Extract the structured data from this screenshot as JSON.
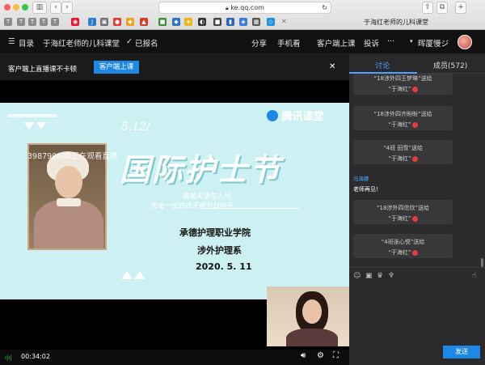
{
  "browser": {
    "url": "ke.qq.com",
    "tab_title": "于海红老师的儿科课堂",
    "fav_letters": [
      "T",
      "T",
      "T",
      "T",
      "T",
      "J"
    ]
  },
  "topnav": {
    "menu": "目录",
    "course_title": "于海红老师的儿科课堂",
    "enrolled": "已报名",
    "share": "分享",
    "watch_phone": "手机看",
    "client": "客户端上课",
    "complaint": "投诉",
    "dots": "···",
    "username": "晖厦慢ジ"
  },
  "banner": {
    "text": "客户端上直播课不卡顿",
    "button": "客户端上课",
    "close": "✕"
  },
  "slide": {
    "logo": "腾讯课堂",
    "date_tag": "5.12/",
    "viewer_watermark": "398799688正在观看直播",
    "headline": "国际护士节",
    "sub1": "最美天使在人间",
    "sub2": "祝每一位白衣天使节日快乐",
    "school": "承德护理职业学院",
    "dept": "涉外护理系",
    "date": "2020. 5. 11"
  },
  "controls": {
    "time": "00:34:02"
  },
  "panel": {
    "tab_discuss": "讨论",
    "tab_members": "成员(572)",
    "gifts": [
      {
        "from": "“18涉外四王梦琳”送给",
        "to": "“于海红”"
      },
      {
        "from": "“18涉外四齐盼盼”送给",
        "to": "“于海红”"
      },
      {
        "from": "“4班 田雪”送给",
        "to": "“于海红”"
      },
      {
        "from": "“18涉外四信欣”送给",
        "to": "“于海红”"
      },
      {
        "from": "“4班张心悦”送给",
        "to": "“于海红”"
      }
    ],
    "message": {
      "user": "马海娜",
      "text": "老师再见!"
    },
    "send": "发送"
  },
  "colors": {
    "accent_blue": "#1e88e5",
    "slide_bg": "#cdf0f2",
    "gift_red": "#e43b3b"
  }
}
